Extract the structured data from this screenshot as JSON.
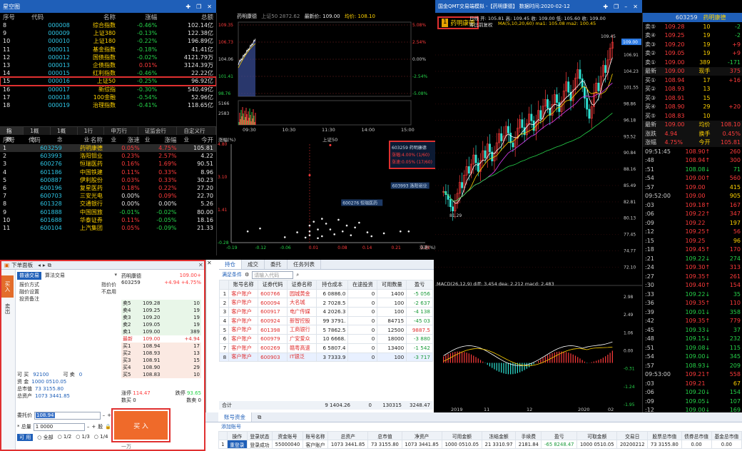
{
  "left_window": {
    "title": "星空图",
    "icons": [
      "pin-icon",
      "restore-icon",
      "close-icon"
    ]
  },
  "index_table": {
    "headers": [
      "序号",
      "代码",
      "名称",
      "涨幅",
      "总额"
    ],
    "rows": [
      [
        "8",
        "000008",
        "综合指数",
        "-0.46%",
        "102.14亿"
      ],
      [
        "9",
        "000009",
        "上证380",
        "-0.13%",
        "122.38亿"
      ],
      [
        "10",
        "000010",
        "上证180",
        "-0.22%",
        "196.89亿"
      ],
      [
        "11",
        "000011",
        "基金指数",
        "-0.18%",
        "41.41亿"
      ],
      [
        "12",
        "000012",
        "国债指数",
        "-0.02%",
        "4121.79万"
      ],
      [
        "13",
        "000013",
        "企债指数",
        "0.01%",
        "3124.39万"
      ],
      [
        "14",
        "000015",
        "红利指数",
        "-0.46%",
        "22.22亿"
      ],
      [
        "15",
        "000016",
        "上证50",
        "-0.25%",
        "96.92亿"
      ],
      [
        "16",
        "000017",
        "新综指",
        "-0.30%",
        "540.49亿"
      ],
      [
        "17",
        "000018",
        "100金融",
        "-0.54%",
        "52.96亿"
      ],
      [
        "18",
        "000019",
        "治理指数",
        "-0.41%",
        "118.65亿"
      ]
    ],
    "tabs": [
      "指数",
      "1概念",
      "1概念",
      "1行业",
      "申万行业",
      "证监会行业",
      "自定义行业"
    ]
  },
  "stock_table": {
    "headers": [
      "序号",
      "代码",
      "名称",
      "涨速",
      "涨幅",
      "今开"
    ],
    "rows": [
      [
        "1",
        "603259",
        "药明康德",
        "0.05%",
        "4.75%",
        "105.81"
      ],
      [
        "2",
        "603993",
        "洛阳钼业",
        "0.23%",
        "2.57%",
        "4.22"
      ],
      [
        "3",
        "600276",
        "恒瑞医药",
        "0.16%",
        "1.69%",
        "90.51"
      ],
      [
        "4",
        "601186",
        "中国铁建",
        "0.11%",
        "0.33%",
        "8.96"
      ],
      [
        "5",
        "600887",
        "伊利股份",
        "0.03%",
        "0.33%",
        "30.23"
      ],
      [
        "6",
        "600196",
        "复星医药",
        "0.18%",
        "0.22%",
        "27.20"
      ],
      [
        "7",
        "600703",
        "三安光电",
        "0.00%",
        "0.09%",
        "22.70"
      ],
      [
        "8",
        "601328",
        "交通银行",
        "0.00%",
        "0.00%",
        "5.26"
      ],
      [
        "9",
        "601888",
        "中国国旅",
        "-0.01%",
        "-0.02%",
        "80.00"
      ],
      [
        "10",
        "601688",
        "华泰证券",
        "0.11%",
        "-0.05%",
        "18.16"
      ],
      [
        "11",
        "600104",
        "上汽集团",
        "0.05%",
        "-0.09%",
        "21.33"
      ]
    ]
  },
  "intraday": {
    "title": "药明康德",
    "index_tag": "上证50 2872.62",
    "latest": "最新价: 109.00",
    "avg": "均价: 108.10",
    "y_left": [
      "109.35",
      "106.73",
      "104.06",
      "101.41",
      "98.76"
    ],
    "y_right": [
      "5.08%",
      "2.54%",
      "0.00%",
      "-2.54%",
      "-5.08%"
    ],
    "vol_labels": [
      "5166",
      "2583"
    ],
    "times": [
      "09:30",
      "10:30",
      "11:30",
      "14:00",
      "15:00"
    ]
  },
  "scatter": {
    "title_left": "涨幅(%)",
    "index_label": "上证50",
    "y_ticks": [
      "4.80",
      "3.10",
      "1.41",
      "-0.28"
    ],
    "x_ticks": [
      "-0.19",
      "-0.12",
      "-0.06",
      "0.01",
      "0.08",
      "0.14",
      "0.21",
      "0.28"
    ],
    "x_label": "涨速(%)",
    "label_600276": "600276 恒瑞医药",
    "label_603993": "603993 洛阳钼业",
    "tooltip": {
      "line1": "603259 药明康德",
      "line2": "涨幅:4.00% (1/60)",
      "line3": "涨速:0.05% (17/60)"
    }
  },
  "order_panel": {
    "title": "下单面板",
    "tab_normal": "普通交易",
    "tab_algo": "算法交易",
    "side_buy": "买入",
    "side_sell": "卖出",
    "fields": [
      [
        "报价方式",
        "指价价"
      ],
      [
        "融价设置",
        "不启用"
      ],
      [
        "投资备注",
        ""
      ]
    ],
    "stock_name": "药明康德",
    "stock_code": "603259",
    "stock_price": "109.00+",
    "stock_change": "+4.94 +4.75%",
    "asks": [
      [
        "卖5",
        "109.28",
        "10"
      ],
      [
        "卖4",
        "109.25",
        "19"
      ],
      [
        "卖3",
        "109.20",
        "19"
      ],
      [
        "卖2",
        "109.05",
        "19"
      ],
      [
        "卖1",
        "109.00",
        "389"
      ]
    ],
    "last_label": "最新",
    "last_price": "109.00",
    "last_chg": "+4.94",
    "bids": [
      [
        "买1",
        "108.94",
        "17"
      ],
      [
        "买2",
        "108.93",
        "13"
      ],
      [
        "买3",
        "108.91",
        "15"
      ],
      [
        "买4",
        "108.90",
        "29"
      ],
      [
        "买5",
        "108.83",
        "10"
      ]
    ],
    "limit_up_label": "涨停",
    "limit_up": "114.47",
    "limit_down_label": "跌停",
    "limit_down": "93.65",
    "vol_label": "数买",
    "vol_val": "0",
    "vol_label2": "数卖",
    "vol_val2": "0",
    "can_buy_label": "可 买",
    "can_buy": "92100",
    "can_sell_label": "可 卖",
    "can_sell": "0",
    "funds": [
      [
        "资 金",
        "1000 0510.05"
      ],
      [
        "总市值",
        "73 3155.80"
      ],
      [
        "总资产",
        "1073 3441.85"
      ]
    ],
    "price_label": "委托价",
    "price_value": "108.94",
    "qty_label": "* 总量",
    "qty_value": "1 0000",
    "qty_unit": "股",
    "available_label": "可 用",
    "radio_options": [
      "全部",
      "1/2",
      "1/3",
      "1/4"
    ],
    "buy_button": "买 入",
    "amount_hint": "一万"
  },
  "holdings": {
    "tabs": [
      "持仓",
      "成交",
      "委托",
      "任务列表"
    ],
    "filter_label": "满足条件",
    "search_placeholder": "请输入代码",
    "headers": [
      "",
      "账号名称",
      "证券代码",
      "证券名称",
      "持仓成本",
      "在途投资",
      "可用数量",
      "盈亏"
    ],
    "rows": [
      [
        "1",
        "客户账户",
        "600766",
        "园城黄金",
        "6 0886.0",
        "0",
        "1400",
        "-5 056"
      ],
      [
        "2",
        "客户账户",
        "600094",
        "大名城",
        "2 7028.5",
        "0",
        "100",
        "-2 637"
      ],
      [
        "3",
        "客户账户",
        "600917",
        "电广传媒",
        "4 2026.3",
        "0",
        "100",
        "-4 138"
      ],
      [
        "4",
        "客户账户",
        "600924",
        "新智控股",
        "99 3791.",
        "0",
        "84715",
        "-45 03"
      ],
      [
        "5",
        "客户账户",
        "601398",
        "工商银行",
        "5 7862.5",
        "0",
        "12500",
        "9887.5"
      ],
      [
        "6",
        "客户账户",
        "600979",
        "广安爱众",
        "10 6668.",
        "0",
        "18000",
        "-3 880"
      ],
      [
        "7",
        "客户账户",
        "600269",
        "赣粤高速",
        "6 5807.4",
        "0",
        "13400",
        "-1 542"
      ],
      [
        "8",
        "客户账户",
        "600903",
        "IT银泛",
        "3 7333.9",
        "0",
        "100",
        "-3 717"
      ]
    ],
    "total_label": "合计",
    "total_cost": "9 1404.26",
    "total_transit": "0",
    "total_qty": "130315",
    "total_pl": "3248.47"
  },
  "account": {
    "tab": "账号资金",
    "add_label": "添加账号",
    "headers": [
      "",
      "操作",
      "登录状态",
      "资金账号",
      "账号名称",
      "总资产",
      "总市值",
      "净资产",
      "可用金额",
      "冻结金额",
      "手续费",
      "盈亏",
      "可取金额",
      "交易日",
      "股票总市值",
      "债券总市值",
      "基金总市值"
    ],
    "row": [
      "1",
      "重登录",
      "登录成功",
      "55000040",
      "客户账户",
      "1073 3441.85",
      "73 3155.80",
      "1073 3441.85",
      "1000 0510.05",
      "21 3310.97",
      "2181.84",
      "-65 8248.47",
      "1000 0510.05",
      "20200212",
      "73 3155.80",
      "0.00",
      "0.00"
    ]
  },
  "kline": {
    "window_title": "国金QMT交易端模拟 -【药明康德】 数据时间:2020-02-12",
    "badge_num": "1",
    "badge_name": "药明康德",
    "header_line1": "日线  开: 105.81  高: 109.45  收: 109.00  低: 105.60  收: 109.00",
    "header_line2": "MA(5,10,20,60)  ma1: 105.08  ma2: 100.45",
    "sub_label": "筹比前复权",
    "y_ticks": [
      "106.91",
      "104.23",
      "101.55",
      "98.86",
      "96.18",
      "93.52",
      "90.84",
      "88.16",
      "85.49",
      "82.81",
      "80.13",
      "77.45",
      "74.77",
      "72.10"
    ],
    "high_label": "109.45",
    "low_label": "81.29",
    "price_tag": "109.00",
    "macd_label": "MACD(26,12,9)  diff: 3.454  dea: 2.212  macd: 2.483",
    "macd_ticks": [
      "2.98",
      "2.49",
      "1.06",
      "0.00",
      "-0.31",
      "-1.24",
      "-1.95"
    ],
    "x_labels": [
      "2019",
      "11",
      "12",
      "2020",
      "02"
    ],
    "icons": [
      "pin-icon",
      "restore-icon",
      "minimize-icon",
      "close-icon"
    ],
    "series": {
      "close": [
        84.5,
        84.0,
        83.2,
        82.0,
        81.3,
        82.5,
        84.2,
        86.0,
        85.1,
        87.2,
        88.6,
        87.5,
        89.0,
        90.5,
        89.2,
        87.8,
        89.6,
        91.2,
        90.0,
        92.3,
        91.0,
        89.5,
        90.8,
        92.5,
        94.0,
        92.8,
        93.6,
        95.2,
        94.1,
        92.5,
        91.8,
        93.2,
        94.9,
        96.3,
        95.0,
        93.8,
        95.6,
        97.2,
        96.1,
        94.5,
        95.9,
        97.8,
        96.4,
        98.5,
        99.6,
        98.2,
        97.0,
        98.8,
        100.4,
        99.1,
        97.6,
        99.3,
        101.0,
        102.5,
        100.8,
        99.4,
        101.2,
        103.1,
        104.5,
        103.0,
        101.6,
        99.8,
        98.0,
        96.5,
        98.4,
        100.6,
        102.3,
        101.0,
        103.4,
        105.2,
        104.0,
        106.1,
        108.0,
        109.0
      ]
    }
  },
  "quote": {
    "code": "603259",
    "name": "药明康德",
    "asks": [
      [
        "卖⑤",
        "109.28",
        "10",
        "-2"
      ],
      [
        "卖④",
        "109.25",
        "19",
        "-2"
      ],
      [
        "卖③",
        "109.20",
        "19",
        "+9"
      ],
      [
        "卖②",
        "109.05",
        "19",
        "+9"
      ],
      [
        "卖①",
        "109.00",
        "389",
        "-171"
      ]
    ],
    "stats1": [
      [
        "最新",
        "109.00",
        "现手",
        "375"
      ]
    ],
    "bids": [
      [
        "买①",
        "108.94",
        "17",
        "+16"
      ],
      [
        "买②",
        "108.93",
        "13",
        ""
      ],
      [
        "买③",
        "108.91",
        "15",
        ""
      ],
      [
        "买④",
        "108.90",
        "29",
        "+20"
      ],
      [
        "买⑤",
        "108.83",
        "10",
        ""
      ]
    ],
    "stats2": [
      [
        "最新",
        "109.00",
        "均价",
        "108.10"
      ],
      [
        "涨跌",
        "4.94",
        "换手",
        "0.45%"
      ],
      [
        "涨幅",
        "4.75%",
        "今开",
        "105.81"
      ]
    ],
    "ticks": [
      [
        "09:51:45",
        "108.90",
        "↑",
        "260"
      ],
      [
        ":48",
        "108.94",
        "↑",
        "300"
      ],
      [
        ":51",
        "108.08",
        "↓",
        "71"
      ],
      [
        ":54",
        "109.00",
        "↑",
        "560"
      ],
      [
        ":57",
        "109.00",
        "",
        "415"
      ],
      [
        "09:52:00",
        "109.00",
        "",
        "905"
      ],
      [
        ":03",
        "109.18",
        "↑",
        "167"
      ],
      [
        ":06",
        "109.22",
        "↑",
        "347"
      ],
      [
        ":09",
        "109.22",
        "",
        "197"
      ],
      [
        ":12",
        "109.25",
        "↑",
        "56"
      ],
      [
        ":15",
        "109.25",
        "",
        "96"
      ],
      [
        ":18",
        "109.45",
        "↑",
        "170"
      ],
      [
        ":21",
        "109.22",
        "↓",
        "274"
      ],
      [
        ":24",
        "109.30",
        "↑",
        "313"
      ],
      [
        ":27",
        "109.35",
        "↑",
        "261"
      ],
      [
        ":30",
        "109.40",
        "↑",
        "154"
      ],
      [
        ":33",
        "109.22",
        "↓",
        "35"
      ],
      [
        ":36",
        "109.35",
        "↑",
        "110"
      ],
      [
        ":39",
        "109.01",
        "↓",
        "358"
      ],
      [
        ":42",
        "109.35",
        "↑",
        "779"
      ],
      [
        ":45",
        "109.33",
        "↓",
        "37"
      ],
      [
        ":48",
        "109.15",
        "↓",
        "232"
      ],
      [
        ":51",
        "109.08",
        "↓",
        "115"
      ],
      [
        ":54",
        "109.00",
        "↓",
        "345"
      ],
      [
        ":57",
        "108.93",
        "↓",
        "209"
      ],
      [
        "09:53:00",
        "109.21",
        "↑",
        "558"
      ],
      [
        ":03",
        "109.21",
        "",
        "67"
      ],
      [
        ":06",
        "109.20",
        "↓",
        "154"
      ],
      [
        ":09",
        "109.05",
        "↓",
        "107"
      ],
      [
        ":12",
        "109.00",
        "↓",
        "169"
      ],
      [
        ":15",
        "109.00",
        "",
        "375"
      ]
    ],
    "bottom_tabs": [
      "分笔",
      "分价",
      "走势",
      "相关"
    ]
  }
}
